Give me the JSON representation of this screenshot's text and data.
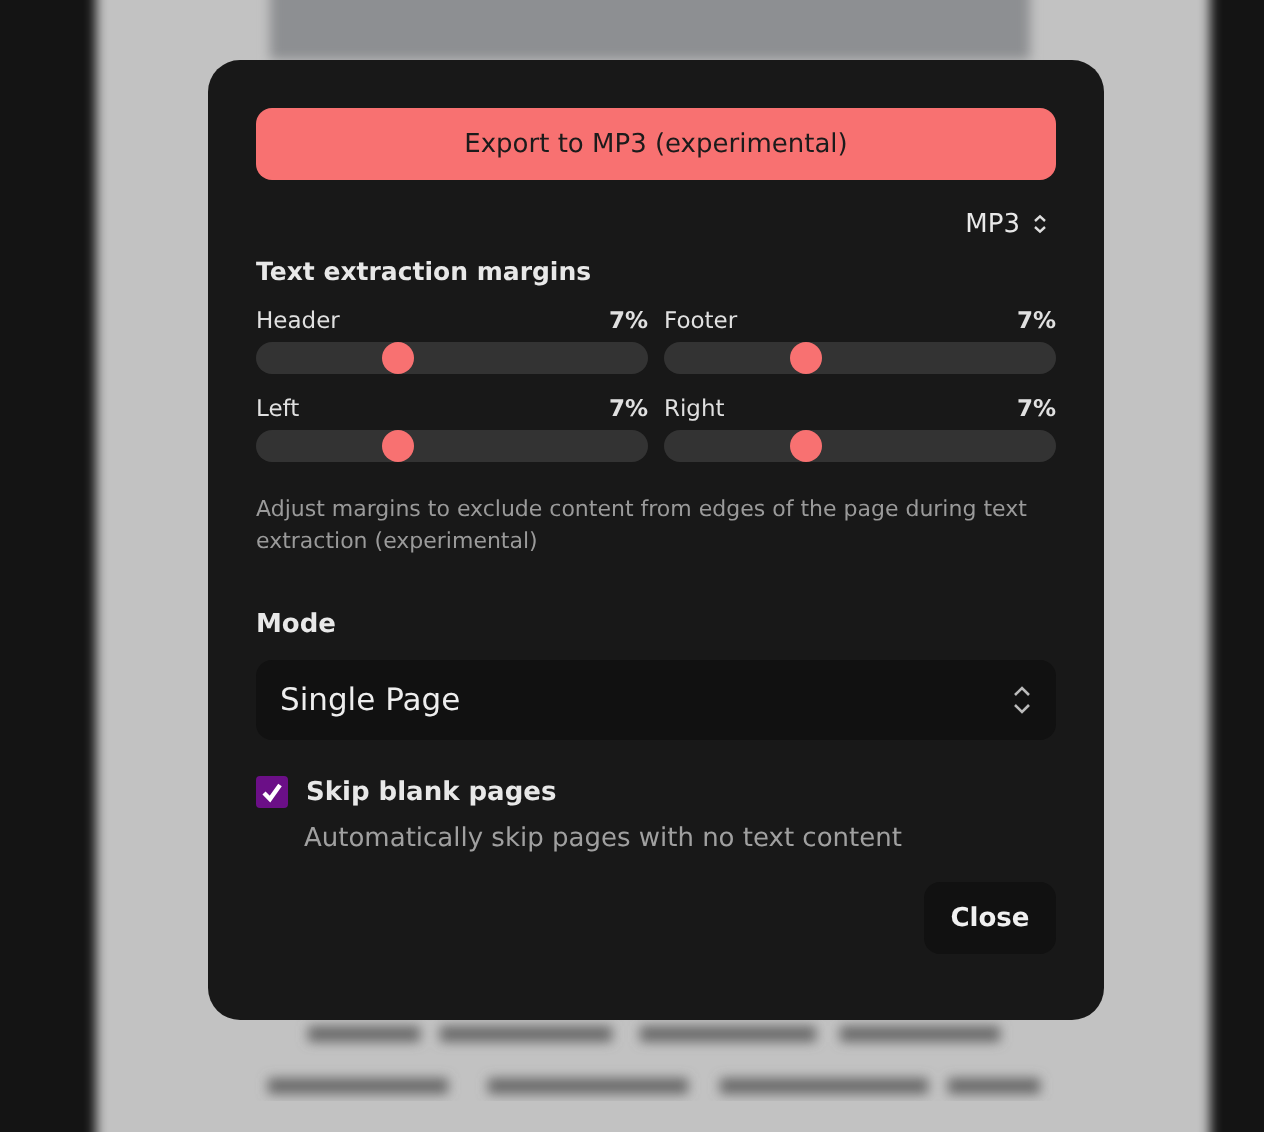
{
  "export_button": {
    "label": "Export to MP3 (experimental)"
  },
  "format_select": {
    "value": "MP3"
  },
  "margins": {
    "title": "Text extraction margins",
    "sliders": [
      {
        "label": "Header",
        "reading": "7%",
        "level": 0.36
      },
      {
        "label": "Footer",
        "reading": "7%",
        "level": 0.36
      },
      {
        "label": "Left",
        "reading": "7%",
        "level": 0.36
      },
      {
        "label": "Right",
        "reading": "7%",
        "level": 0.36
      }
    ],
    "help": "Adjust margins to exclude content from edges of the page during text extraction (experimental)"
  },
  "mode": {
    "label": "Mode",
    "value": "Single Page"
  },
  "skip_blank": {
    "label": "Skip blank pages",
    "checked": true,
    "description": "Automatically skip pages with no text content"
  },
  "close_button": {
    "label": "Close"
  }
}
